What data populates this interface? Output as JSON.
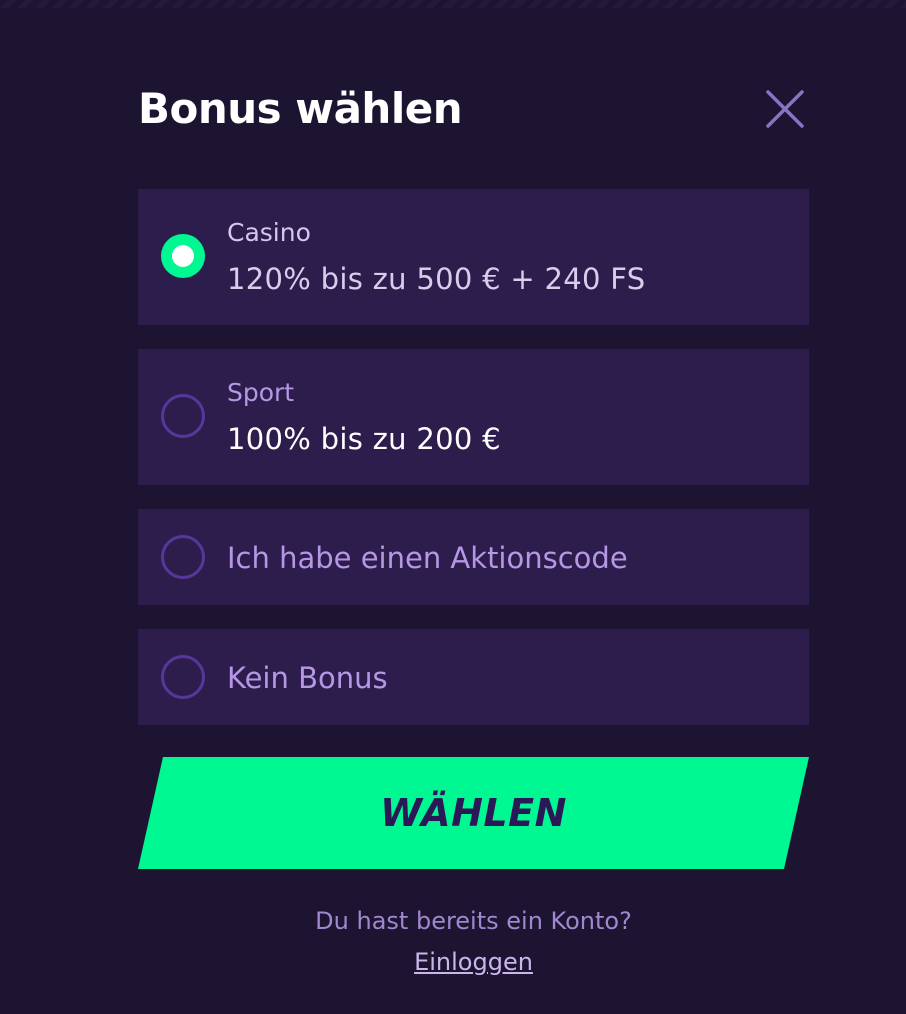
{
  "modal": {
    "title": "Bonus wählen",
    "close_icon": "close-icon"
  },
  "options": [
    {
      "label": "Casino",
      "value": "120% bis zu 500 € + 240 FS",
      "selected": true
    },
    {
      "label": "Sport",
      "value": "100% bis zu 200 €",
      "selected": false
    },
    {
      "label": "Ich habe einen Aktionscode",
      "selected": false
    },
    {
      "label": "Kein Bonus",
      "selected": false
    }
  ],
  "submit": {
    "label": "WÄHLEN"
  },
  "footer": {
    "question": "Du hast bereits ein Konto?",
    "login_link": "Einloggen"
  },
  "colors": {
    "background": "#1c1430",
    "option_background": "#2d1d4d",
    "accent": "#00f893",
    "radio_border": "#55389a",
    "submit_text": "#2b1957"
  }
}
